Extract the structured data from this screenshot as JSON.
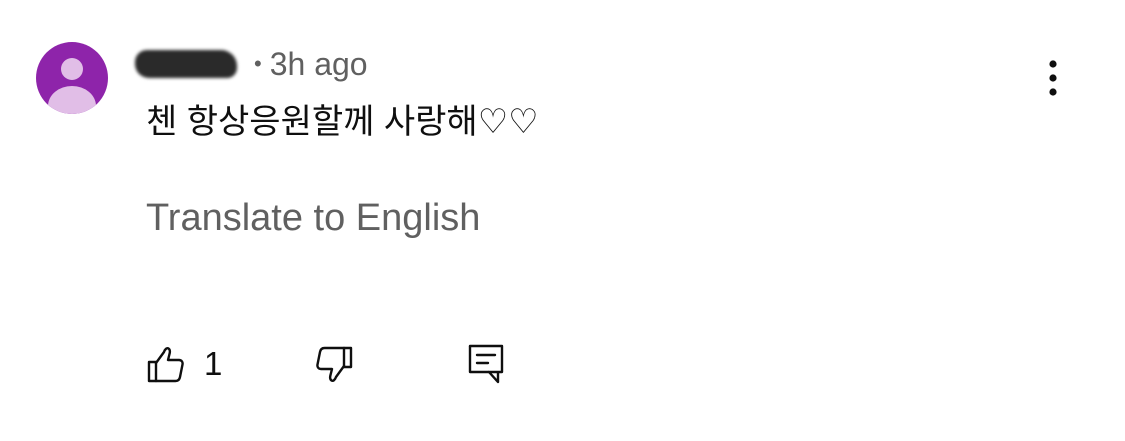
{
  "comment": {
    "avatar_icon": "default-user-avatar-icon",
    "username": "[redacted username]",
    "separator": "•",
    "time_ago": "3h ago",
    "text": "첸 항상응원할께 사랑해♡♡",
    "translate_label": "Translate to English"
  },
  "actions": {
    "more_icon": "vertical-ellipsis-icon",
    "like_icon": "thumbs-up-icon",
    "like_count": "1",
    "dislike_icon": "thumbs-down-icon",
    "reply_icon": "comment-reply-icon"
  },
  "colors": {
    "avatar_bg": "#8e24aa",
    "avatar_fg": "#e1bee7",
    "primary_text": "#0f0f0f",
    "secondary_text": "#606060",
    "icon": "#0f0f0f",
    "background": "#ffffff"
  }
}
